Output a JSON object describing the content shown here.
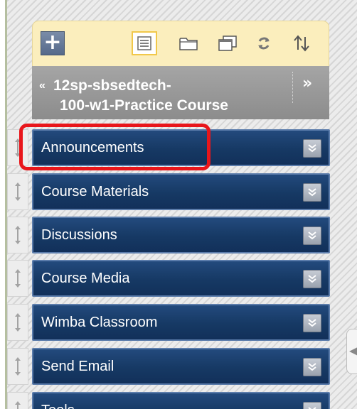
{
  "toolbar": {
    "add_label": "+",
    "icons": [
      "list-view-icon",
      "folder-icon",
      "window-icon",
      "refresh-icon",
      "sort-icon"
    ],
    "active_icon": "list-view-icon"
  },
  "course": {
    "collapse_chevron": "«",
    "title_line1": "12sp-sbsedtech-",
    "title_line2": "100-w1-Practice Course",
    "expand_label": "»"
  },
  "menu": {
    "items": [
      {
        "label": "Announcements"
      },
      {
        "label": "Course Materials"
      },
      {
        "label": "Discussions"
      },
      {
        "label": "Course Media"
      },
      {
        "label": "Wimba Classroom"
      },
      {
        "label": "Send Email"
      },
      {
        "label": "Tools"
      }
    ],
    "highlighted": "Announcements"
  },
  "colors": {
    "toolbar_bg": "#fbeebd",
    "menu_button_bg": "#163964",
    "highlight": "#e8161b",
    "course_header_bg": "#999999"
  }
}
